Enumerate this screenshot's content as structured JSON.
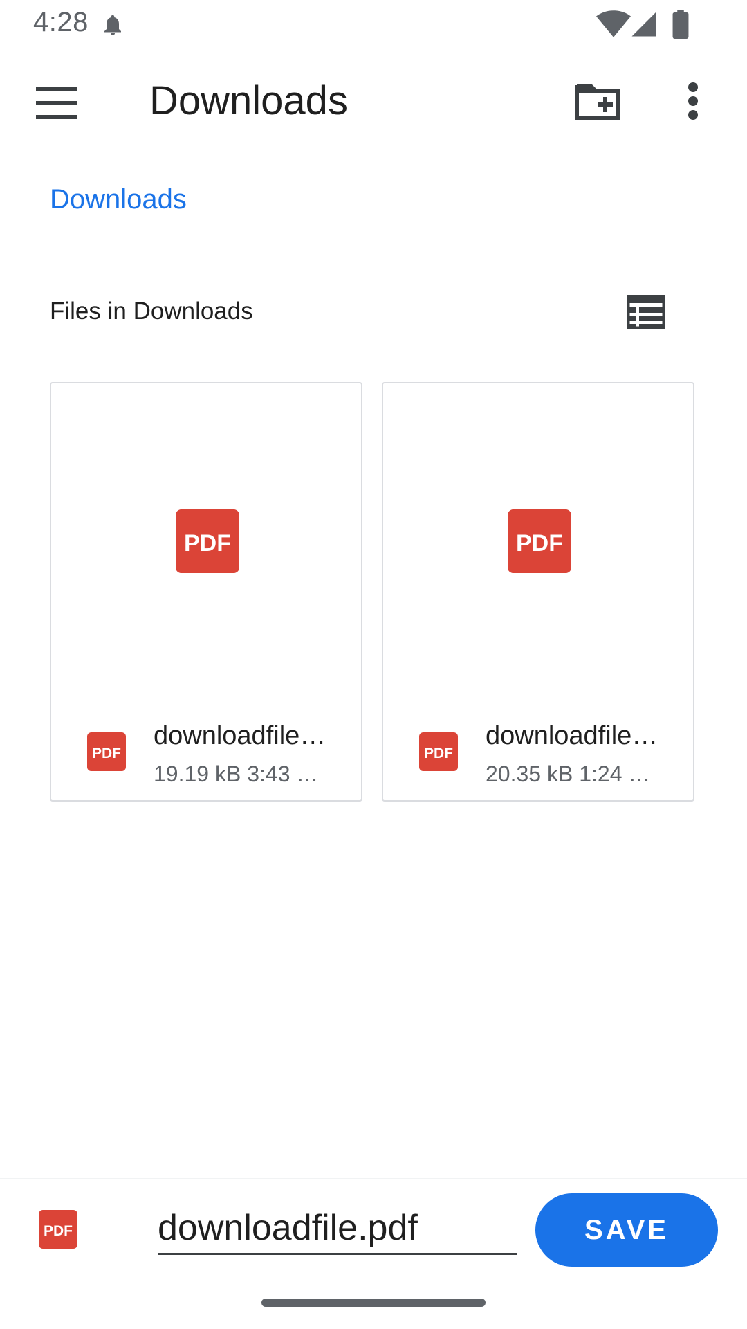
{
  "status_bar": {
    "time": "4:28"
  },
  "app_bar": {
    "title": "Downloads",
    "icons": [
      "menu-icon",
      "create-folder-icon",
      "more-vert-icon"
    ]
  },
  "breadcrumb": {
    "label": "Downloads"
  },
  "section": {
    "title": "Files in Downloads"
  },
  "files": [
    {
      "name": "downloadfile…",
      "meta": "19.19 kB 3:43 …",
      "icon": "pdf-icon"
    },
    {
      "name": "downloadfile…",
      "meta": "20.35 kB 1:24 …",
      "icon": "pdf-icon"
    }
  ],
  "save_bar": {
    "filename_value": "downloadfile.pdf",
    "save_label": "SAVE"
  },
  "colors": {
    "accent": "#1a73e8",
    "pdf_red": "#db4437"
  }
}
